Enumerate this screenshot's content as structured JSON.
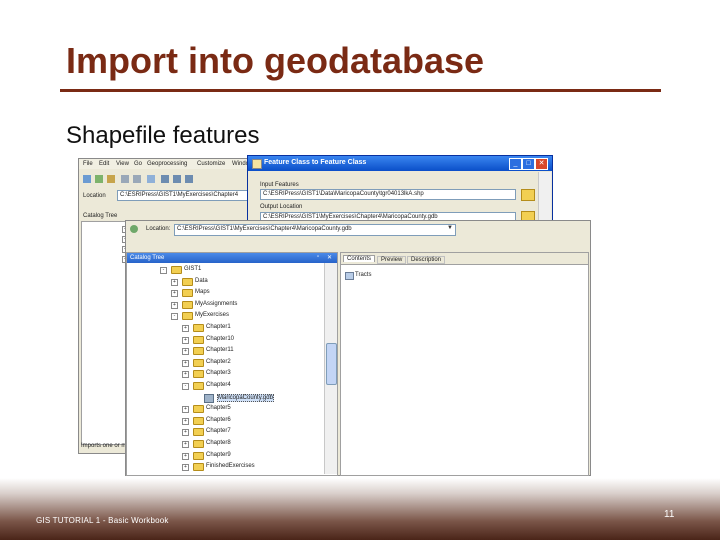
{
  "slide": {
    "title": "Import into geodatabase",
    "subtitle": "Shapefile features",
    "footer": "GIS TUTORIAL 1 - Basic Workbook",
    "page_number": "11"
  },
  "arcmap": {
    "menu": [
      "File",
      "Edit",
      "View",
      "Go",
      "Geoprocessing",
      "Customize",
      "Windo"
    ],
    "location_label": "Location",
    "location_value": "C:\\ESRIPress\\GIST1\\MyExercises\\Chapter4",
    "catalog_tree_label": "Catalog Tree",
    "status": "Imports one or mor"
  },
  "dialog": {
    "title": "Feature Class to Feature Class",
    "input_label": "Input Features",
    "input_value": "C:\\ESRIPress\\GIST1\\Data\\MaricopaCounty\\tgr04013lkA.shp",
    "output_label": "Output Location",
    "output_value": "C:\\ESRIPress\\GIST1\\MyExercises\\Chapter4\\MaricopaCounty.gdb"
  },
  "catalog": {
    "location_label": "Location:",
    "location_value": "C:\\ESRIPress\\GIST1\\MyExercises\\Chapter4\\MaricopaCounty.gdb",
    "tree_title": "Catalog Tree",
    "tabs": [
      "Contents",
      "Preview",
      "Description"
    ],
    "content_item": "Tracts",
    "tree": [
      {
        "label": "GIST1",
        "depth": 0,
        "exp": "-"
      },
      {
        "label": "Data",
        "depth": 1,
        "exp": "+"
      },
      {
        "label": "Maps",
        "depth": 1,
        "exp": "+"
      },
      {
        "label": "MyAssignments",
        "depth": 1,
        "exp": "+"
      },
      {
        "label": "MyExercises",
        "depth": 1,
        "exp": "-"
      },
      {
        "label": "Chapter1",
        "depth": 2,
        "exp": "+"
      },
      {
        "label": "Chapter10",
        "depth": 2,
        "exp": "+"
      },
      {
        "label": "Chapter11",
        "depth": 2,
        "exp": "+"
      },
      {
        "label": "Chapter2",
        "depth": 2,
        "exp": "+"
      },
      {
        "label": "Chapter3",
        "depth": 2,
        "exp": "+"
      },
      {
        "label": "Chapter4",
        "depth": 2,
        "exp": "-"
      },
      {
        "label": "MaricopaCounty.gdb",
        "depth": 3,
        "exp": ""
      },
      {
        "label": "Chapter5",
        "depth": 2,
        "exp": "+"
      },
      {
        "label": "Chapter6",
        "depth": 2,
        "exp": "+"
      },
      {
        "label": "Chapter7",
        "depth": 2,
        "exp": "+"
      },
      {
        "label": "Chapter8",
        "depth": 2,
        "exp": "+"
      },
      {
        "label": "Chapter9",
        "depth": 2,
        "exp": "+"
      },
      {
        "label": "FinishedExercises",
        "depth": 2,
        "exp": "+"
      }
    ]
  },
  "colors": {
    "title": "#7a2a14",
    "xp_title_bar": "#0a5fd8",
    "catalog_title_bar": "#2b6fd6"
  }
}
